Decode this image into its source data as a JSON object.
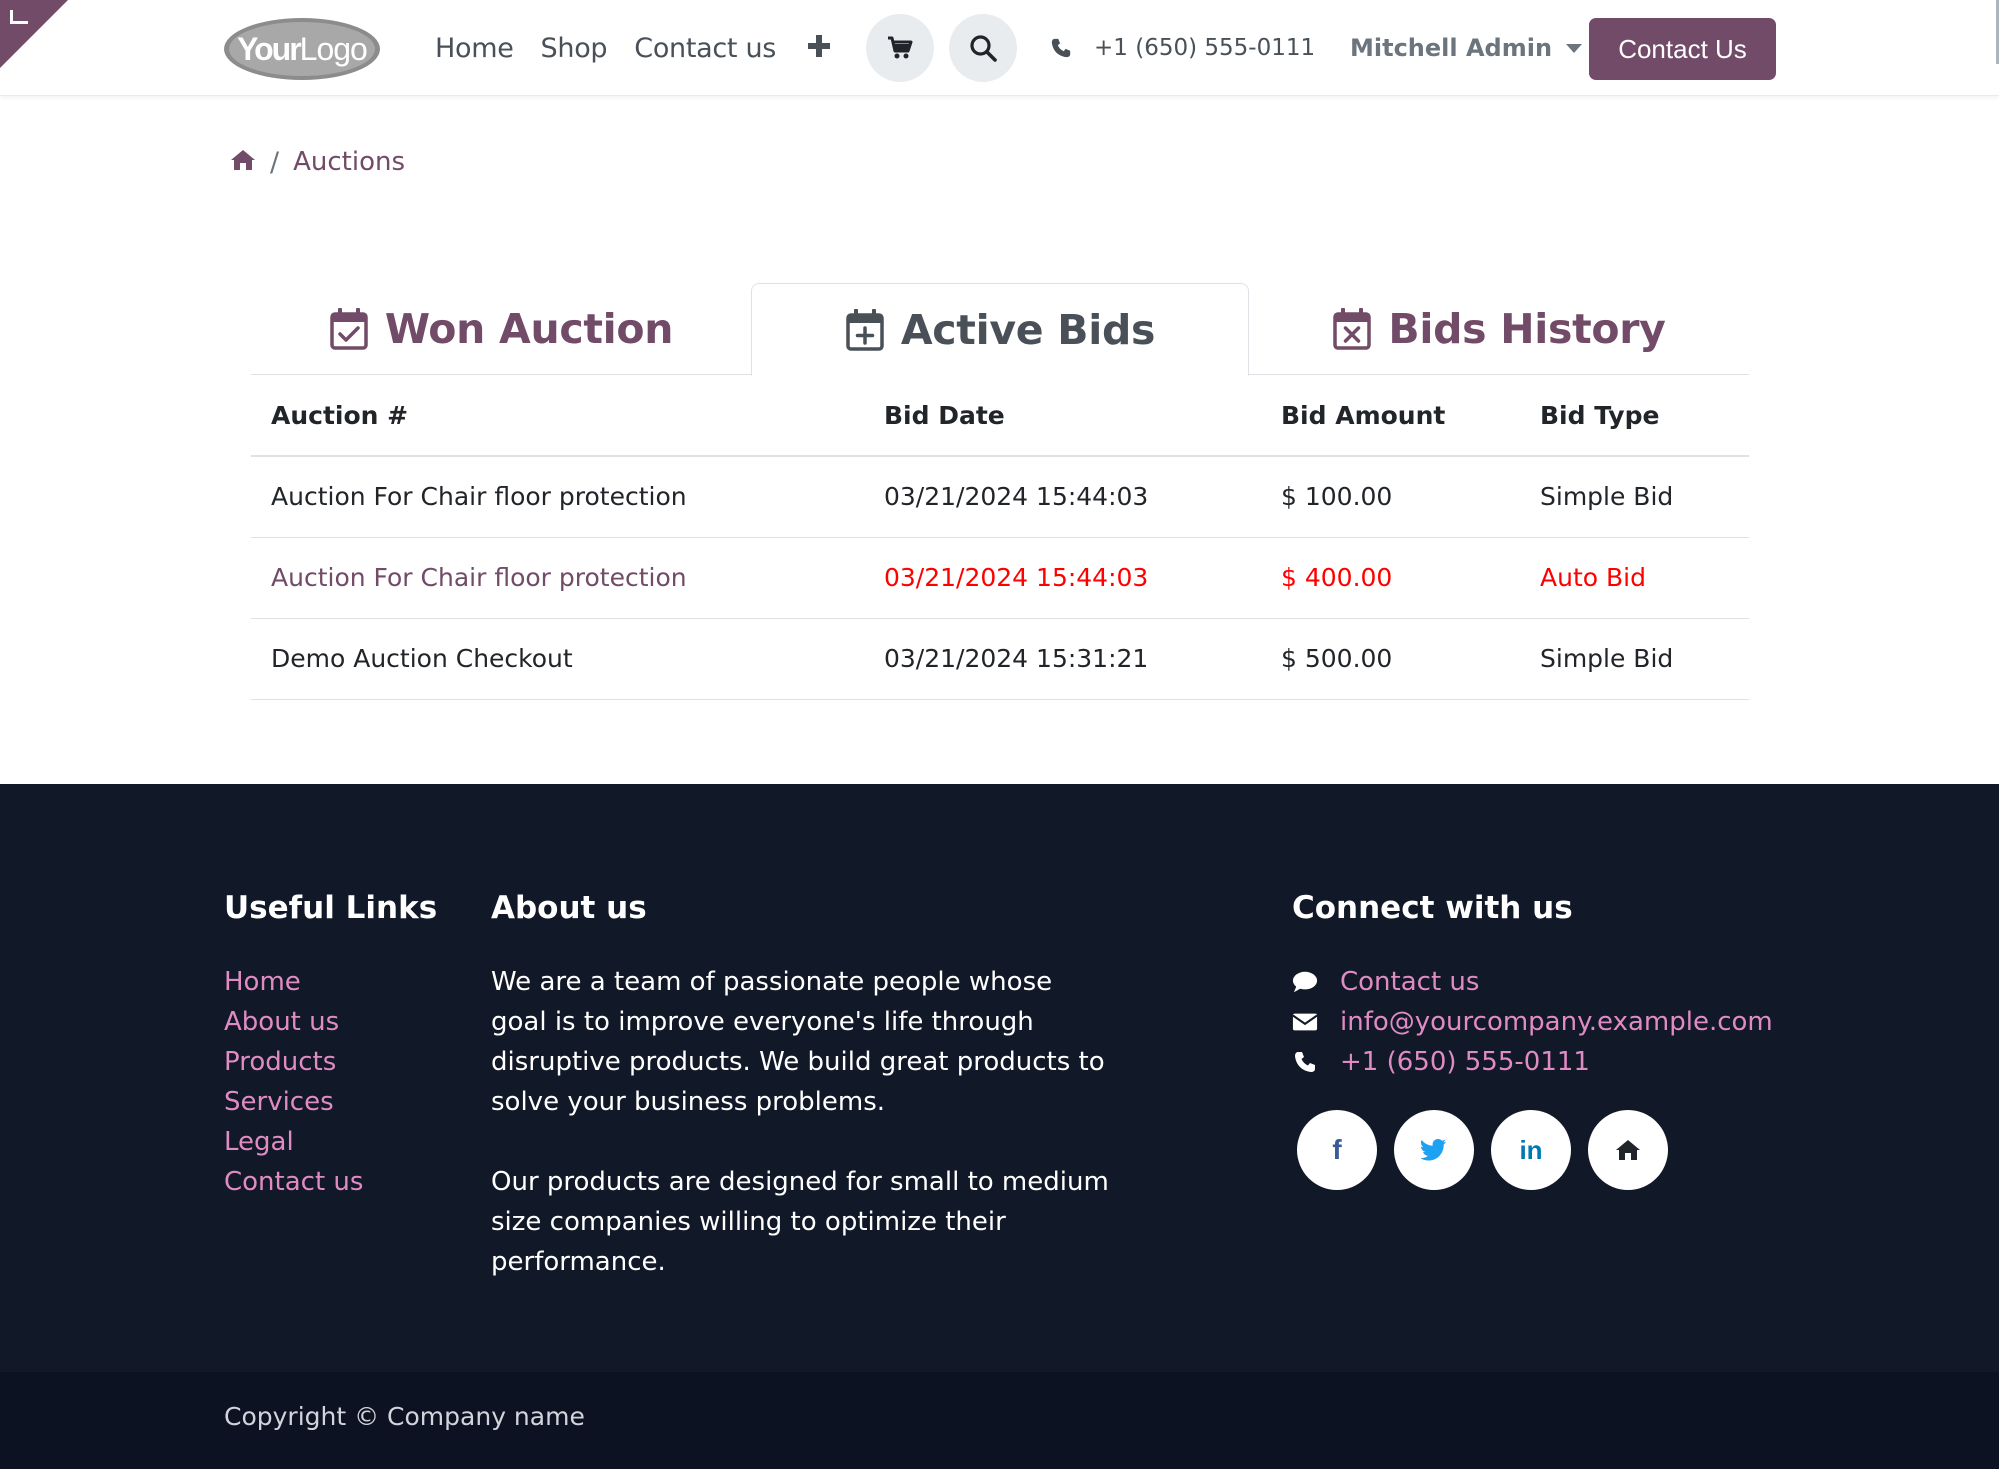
{
  "header": {
    "logo_text": "YourLogo",
    "nav": [
      {
        "label": "Home"
      },
      {
        "label": "Shop"
      },
      {
        "label": "Contact us"
      }
    ],
    "add_icon": "plus-icon",
    "cart_icon": "cart-icon",
    "search_icon": "search-icon",
    "phone": "+1 (650) 555-0111",
    "user": "Mitchell Admin",
    "cta_label": "Contact Us"
  },
  "breadcrumb": {
    "home_icon": "home-icon",
    "separator": "/",
    "current": "Auctions"
  },
  "tabs": [
    {
      "label": "Won Auction",
      "icon": "calendar-check-icon",
      "active": false
    },
    {
      "label": "Active Bids",
      "icon": "calendar-plus-icon",
      "active": true
    },
    {
      "label": "Bids History",
      "icon": "calendar-x-icon",
      "active": false
    }
  ],
  "table": {
    "columns": [
      "Auction #",
      "Bid Date",
      "Bid Amount",
      "Bid Type"
    ],
    "rows": [
      {
        "auction": "Auction For Chair floor protection",
        "date": "03/21/2024 15:44:03",
        "amount": "$ 100.00",
        "type": "Simple Bid",
        "highlight": false
      },
      {
        "auction": "Auction For Chair floor protection",
        "date": "03/21/2024 15:44:03",
        "amount": "$ 400.00",
        "type": "Auto Bid",
        "highlight": true
      },
      {
        "auction": "Demo Auction Checkout",
        "date": "03/21/2024 15:31:21",
        "amount": "$ 500.00",
        "type": "Simple Bid",
        "highlight": false
      }
    ]
  },
  "footer": {
    "useful_links": {
      "heading": "Useful Links",
      "items": [
        "Home",
        "About us",
        "Products",
        "Services",
        "Legal",
        "Contact us"
      ]
    },
    "about": {
      "heading": "About us",
      "paragraphs": [
        "We are a team of passionate people whose goal is to improve everyone's life through disruptive products. We build great products to solve your business problems.",
        "Our products are designed for small to medium size companies willing to optimize their performance."
      ]
    },
    "connect": {
      "heading": "Connect with us",
      "items": [
        {
          "icon": "chat-icon",
          "label": "Contact us"
        },
        {
          "icon": "envelope-icon",
          "label": "info@yourcompany.example.com"
        },
        {
          "icon": "phone-icon",
          "label": "+1 (650) 555-0111"
        }
      ],
      "socials": [
        {
          "icon": "facebook-icon",
          "glyph": "f"
        },
        {
          "icon": "twitter-icon",
          "glyph": ""
        },
        {
          "icon": "linkedin-icon",
          "glyph": "in"
        },
        {
          "icon": "home-icon",
          "glyph": ""
        }
      ]
    },
    "copyright": "Copyright © Company name"
  },
  "colors": {
    "brand": "#714B67",
    "footer_bg": "#111827",
    "footer_link": "#e08bc4",
    "highlight_row": "#ff0000"
  }
}
